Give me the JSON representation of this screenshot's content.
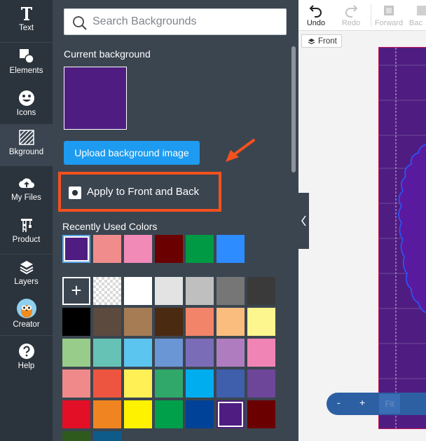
{
  "nav": {
    "items": [
      {
        "label": "Text",
        "icon": "text-icon"
      },
      {
        "label": "Elements",
        "icon": "elements-icon"
      },
      {
        "label": "Icons",
        "icon": "smiley-icon"
      },
      {
        "label": "Bkground",
        "icon": "background-hatch-icon"
      },
      {
        "label": "My Files",
        "icon": "cloud-upload-icon"
      },
      {
        "label": "Product",
        "icon": "product-crane-icon"
      },
      {
        "label": "Layers",
        "icon": "layers-icon"
      },
      {
        "label": "Creator",
        "icon": "owl-avatar-icon"
      },
      {
        "label": "Help",
        "icon": "help-icon"
      }
    ],
    "active_index": 3
  },
  "panel": {
    "search_placeholder": "Search Backgrounds",
    "current_background_label": "Current background",
    "current_background_color": "#4f1d81",
    "upload_button": "Upload background image",
    "apply_label": "Apply to Front and Back",
    "recent_label": "Recently Used Colors",
    "recent_colors": [
      "#4f1d81",
      "#f08c8c",
      "#f28ab8",
      "#6b0000",
      "#009a44",
      "#2d8cff"
    ],
    "palette": [
      [
        "add",
        "transparent",
        "#ffffff",
        "#e3e3e3",
        "#bfbfbf",
        "#767676",
        "#3a3a3a"
      ],
      [
        "#000000",
        "#5c4a3e",
        "#a67c55",
        "#4a2a10",
        "#f2846a",
        "#fbbd7e",
        "#fdf58d"
      ],
      [
        "#97cc8a",
        "#66c2b5",
        "#5bc4ef",
        "#6b96d6",
        "#7b6cb8",
        "#b07cc0",
        "#f085b5"
      ],
      [
        "#f08a8a",
        "#ee5540",
        "#fff056",
        "#2fa86a",
        "#00aeef",
        "#3f5fac",
        "#6d4599"
      ],
      [
        "#e30f26",
        "#f08420",
        "#fff200",
        "#00a04a",
        "#004297",
        "#4f1d81",
        "#6b0000"
      ],
      [
        "#2e5a1e",
        "#0e5b8a"
      ]
    ],
    "selected_palette_color": "#4f1d81"
  },
  "toolbar": {
    "undo": "Undo",
    "redo": "Redo",
    "forward": "Forward",
    "backward": "Bac"
  },
  "canvas": {
    "side_tab": "Front",
    "design_color": "#4f1d81",
    "zoom_minus": "-",
    "zoom_plus": "+",
    "zoom_fit": "Fit"
  },
  "colors": {
    "nav_bg": "#2b333c",
    "panel_bg": "#3b4550",
    "accent_blue": "#1d9bf0",
    "highlight_orange": "#f4511e"
  }
}
